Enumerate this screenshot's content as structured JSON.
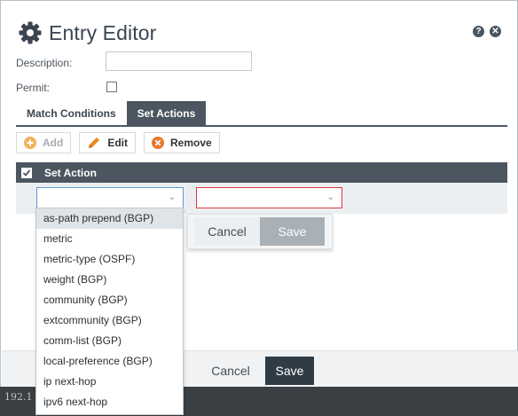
{
  "dialog": {
    "title": "Entry Editor",
    "help_icon": "question-circle-icon",
    "close_icon": "close-circle-icon"
  },
  "form": {
    "description_label": "Description:",
    "description_value": "",
    "permit_label": "Permit:",
    "permit_checked": false
  },
  "tabs": [
    {
      "label": "Match Conditions",
      "active": false
    },
    {
      "label": "Set Actions",
      "active": true
    }
  ],
  "toolbar": {
    "add_label": "Add",
    "edit_label": "Edit",
    "remove_label": "Remove"
  },
  "grid": {
    "header_label": "Set Action",
    "row": {
      "action_select_value": "",
      "value_select_value": ""
    }
  },
  "row_editor": {
    "cancel_label": "Cancel",
    "save_label": "Save"
  },
  "footer": {
    "cancel_label": "Cancel",
    "save_label": "Save"
  },
  "statusbar": {
    "text": "192.1"
  },
  "dropdown": {
    "options": [
      "as-path prepend (BGP)",
      "metric",
      "metric-type (OSPF)",
      "weight (BGP)",
      "community (BGP)",
      "extcommunity (BGP)",
      "comm-list (BGP)",
      "local-preference (BGP)",
      "ip next-hop",
      "ipv6 next-hop"
    ],
    "highlighted_index": 0
  },
  "colors": {
    "header_dark": "#4b5661",
    "save_dark": "#2f3c46",
    "add_orange": "#f2b25c",
    "edit_orange": "#e8891f",
    "remove_orange": "#e8772c",
    "focus_blue": "#5b9bd5",
    "error_red": "#e0383d"
  }
}
